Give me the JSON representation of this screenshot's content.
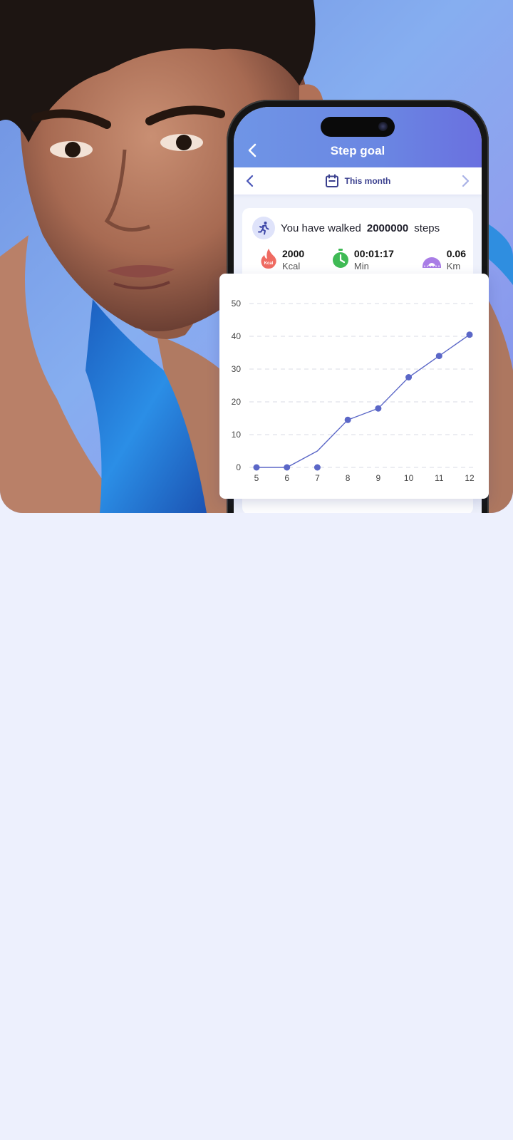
{
  "app": {
    "title": "Step goal",
    "period_label": "This month"
  },
  "summary": {
    "prefix": "You have walked",
    "steps": "2000000",
    "suffix": "steps"
  },
  "metrics": [
    {
      "icon": "flame-icon",
      "value": "2000",
      "unit": "Kcal",
      "color": "#ef5b5b"
    },
    {
      "icon": "stopwatch-icon",
      "value": "00:01:17",
      "unit": "Min",
      "color": "#3fba55"
    },
    {
      "icon": "ruler-arc-icon",
      "value": "0.06",
      "unit": "Km",
      "color": "#a97de6"
    }
  ],
  "colors": {
    "accent": "#5b67c7",
    "header_gradient_start": "#6f95e6",
    "header_gradient_end": "#6a70e0",
    "page_background": "#edf0fd"
  },
  "chart_data": {
    "type": "line",
    "title": "",
    "xlabel": "",
    "ylabel": "",
    "x": [
      5,
      6,
      7,
      8,
      9,
      10,
      11,
      12
    ],
    "series": [
      {
        "values": [
          0,
          0,
          0,
          14.5,
          18,
          27.5,
          34,
          40.5
        ]
      }
    ],
    "extra_line_point": {
      "x": 7,
      "y": 5
    },
    "ylim": [
      0,
      50
    ],
    "yticks": [
      0,
      10,
      20,
      30,
      40,
      50
    ],
    "grid": true,
    "legend": "none"
  }
}
